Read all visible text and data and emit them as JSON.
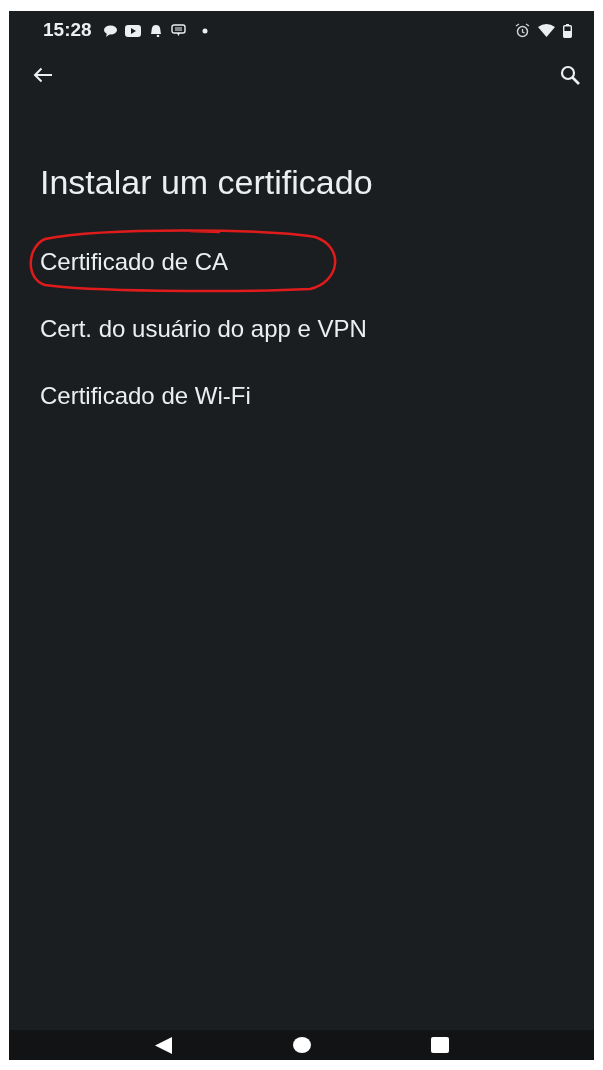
{
  "status_bar": {
    "time": "15:28"
  },
  "app_bar": {
    "back": true,
    "search": true
  },
  "title": "Instalar um certificado",
  "items": [
    {
      "label": "Certificado de CA",
      "circled": true
    },
    {
      "label": "Cert. do usuário do app e VPN",
      "circled": false
    },
    {
      "label": "Certificado de Wi-Fi",
      "circled": false
    }
  ]
}
